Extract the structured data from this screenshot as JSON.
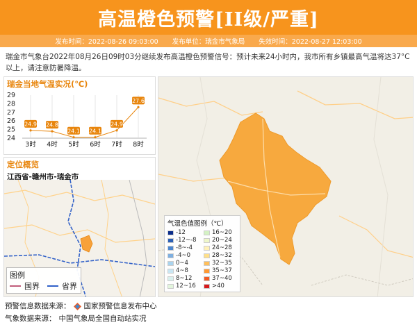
{
  "header": {
    "title": "高温橙色预警[II级/严重]",
    "issue_time": "发布时间：2022-08-26 09:03:00",
    "issuer": "发布单位：瑞金市气象局",
    "expire_time": "失效时间：2022-08-27 12:03:00"
  },
  "description": "瑞金市气象台2022年08月26日09时03分继续发布高温橙色预警信号：预计未来24小时内，我市所有乡镇最高气温将达37°C以上，请注意防暑降温。",
  "temp_panel": {
    "title": "瑞金当地气温实况(℃)"
  },
  "chart_data": {
    "type": "line",
    "title": "瑞金当地气温实况(℃)",
    "categories": [
      "3时",
      "4时",
      "5时",
      "6时",
      "7时",
      "8时"
    ],
    "values": [
      24.9,
      24.8,
      24.1,
      24.1,
      24.9,
      27.6
    ],
    "yticks": [
      24,
      25,
      26,
      27,
      28,
      29
    ],
    "ylim": [
      24,
      29
    ],
    "point_color": "#e8850c"
  },
  "location_panel": {
    "title": "定位概览",
    "location": "江西省-赣州市-瑞金市"
  },
  "mini_map_legend": {
    "title": "图例",
    "national_border": "国界",
    "provincial_border": "省界"
  },
  "map_legend": {
    "title": "气温色值图例（℃）",
    "items": [
      {
        "label": "-12",
        "color": "#0b2d8a"
      },
      {
        "label": "16~20",
        "color": "#d4f2c4"
      },
      {
        "label": "-12~-8",
        "color": "#2a5fb5"
      },
      {
        "label": "20~24",
        "color": "#eef7c9"
      },
      {
        "label": "-8~-4",
        "color": "#4b86cf"
      },
      {
        "label": "24~28",
        "color": "#fff1b8"
      },
      {
        "label": "-4~0",
        "color": "#7eafe0"
      },
      {
        "label": "28~32",
        "color": "#ffe08a"
      },
      {
        "label": "0~4",
        "color": "#a9d3ee"
      },
      {
        "label": "32~35",
        "color": "#ffbf5a"
      },
      {
        "label": "4~8",
        "color": "#c9e6f3"
      },
      {
        "label": "35~37",
        "color": "#ff9933"
      },
      {
        "label": "8~12",
        "color": "#d9f0ee"
      },
      {
        "label": "37~40",
        "color": "#f15a24"
      },
      {
        "label": "12~16",
        "color": "#e2f5dc"
      },
      {
        "label": ">40",
        "color": "#d7191c"
      }
    ]
  },
  "footer": {
    "warning_source_label": "预警信息数据来源：",
    "warning_source": "国家预警信息发布中心",
    "weather_source_label": "气象数据来源：",
    "weather_source": "中国气象局全国自动站实况"
  }
}
